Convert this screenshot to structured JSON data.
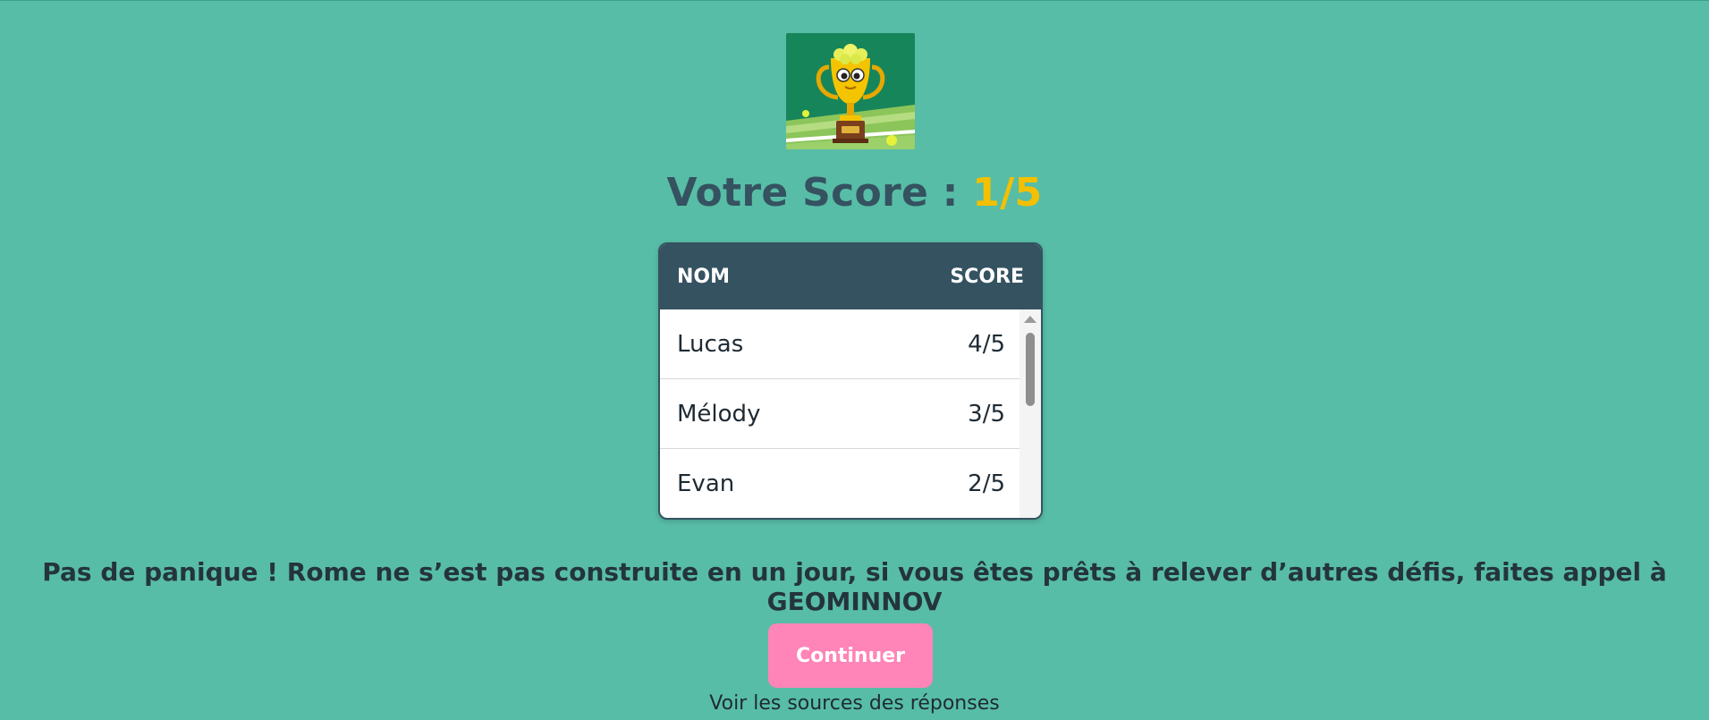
{
  "result": {
    "score_label": "Votre Score :",
    "score_value": "1/5"
  },
  "leaderboard": {
    "columns": [
      "NOM",
      "SCORE"
    ],
    "rows": [
      {
        "name": "Lucas",
        "score": "4/5"
      },
      {
        "name": "Mélody",
        "score": "3/5"
      },
      {
        "name": "Evan",
        "score": "2/5"
      }
    ]
  },
  "message": "Pas de panique ! Rome ne s’est pas construite en un jour, si vous êtes prêts à relever d’autres défis, faites appel à GEOMINNOV",
  "actions": {
    "continue_label": "Continuer",
    "sources_label": "Voir les sources des réponses"
  },
  "icons": {
    "trophy": "trophy-illustration"
  },
  "colors": {
    "background": "#58bda6",
    "header": "#355261",
    "score_accent": "#f5c000",
    "button": "#ff84b8"
  }
}
